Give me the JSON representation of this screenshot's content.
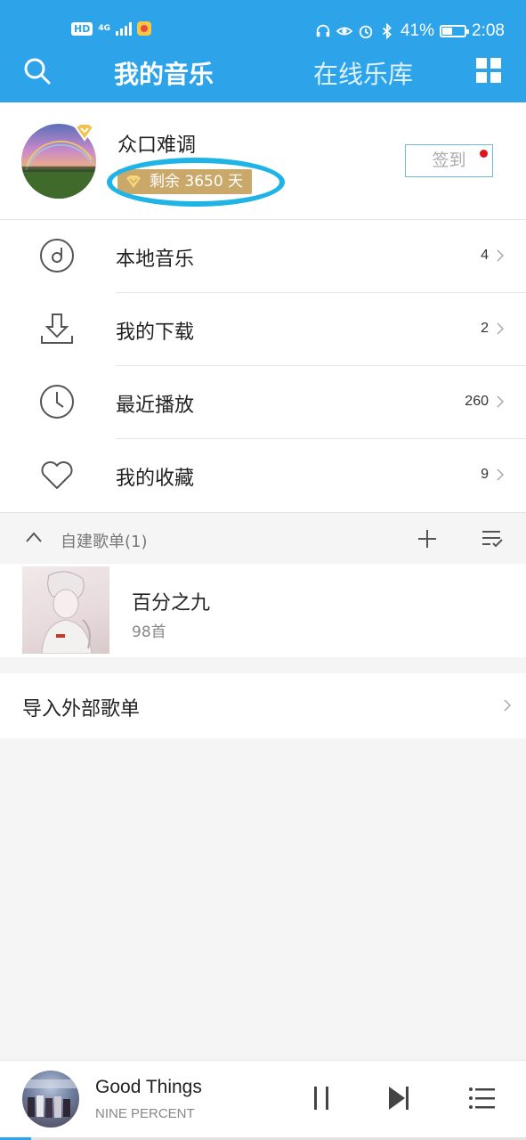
{
  "status_bar": {
    "left": {
      "hd": "HD",
      "network": "4G"
    },
    "right": {
      "battery": "41%",
      "time": "2:08"
    }
  },
  "nav": {
    "tabs": [
      {
        "label": "我的音乐",
        "active": true
      },
      {
        "label": "在线乐库",
        "active": false
      }
    ],
    "icons": [
      "search-icon",
      "grid-icon"
    ]
  },
  "profile": {
    "username": "众口难调",
    "vip_days": "剩余 3650 天",
    "checkin_label": "签到"
  },
  "menu": [
    {
      "label": "本地音乐",
      "count": "4",
      "icon": "disc-icon"
    },
    {
      "label": "我的下载",
      "count": "2",
      "icon": "download-icon"
    },
    {
      "label": "最近播放",
      "count": "260",
      "icon": "clock-icon"
    },
    {
      "label": "我的收藏",
      "count": "9",
      "icon": "heart-icon"
    }
  ],
  "section": {
    "title": "自建歌单(1)"
  },
  "playlists": [
    {
      "title": "百分之九",
      "count": "98首"
    }
  ],
  "import": {
    "label": "导入外部歌单"
  },
  "player": {
    "title": "Good Things",
    "artist": "NINE PERCENT",
    "progress": 0.06
  },
  "colors": {
    "accent": "#2da3ea",
    "vip_gold": "#c9a86a",
    "highlight": "#1eb4e6",
    "badge_red": "#e0131d"
  }
}
